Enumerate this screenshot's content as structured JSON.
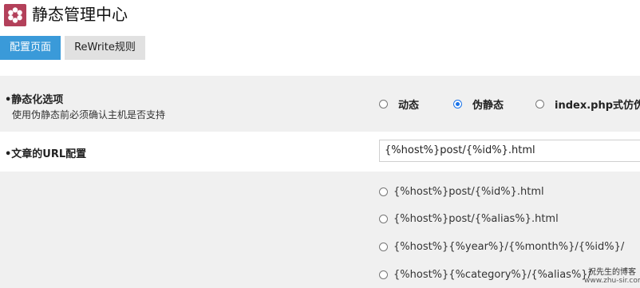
{
  "header": {
    "logo_icon": "flower-logo-icon",
    "logo_color": "#b3405a",
    "title": "静态管理中心"
  },
  "tabs": [
    {
      "label": "配置页面",
      "active": true
    },
    {
      "label": "ReWrite规则",
      "active": false
    }
  ],
  "static_mode": {
    "label": "•静态化选项",
    "sublabel": "使用伪静态前必须确认主机是否支持",
    "options": [
      {
        "label": "动态",
        "checked": false
      },
      {
        "label": "伪静态",
        "checked": true
      },
      {
        "label": "index.php式仿伪",
        "checked": false
      }
    ]
  },
  "article_url": {
    "label": "•文章的URL配置",
    "value": "{%host%}post/{%id%}.html",
    "templates": [
      {
        "label": "{%host%}post/{%id%}.html",
        "checked": false
      },
      {
        "label": "{%host%}post/{%alias%}.html",
        "checked": false
      },
      {
        "label": "{%host%}{%year%}/{%month%}/{%id%}/",
        "checked": false
      },
      {
        "label": "{%host%}{%category%}/{%alias%}/",
        "checked": false
      }
    ]
  },
  "watermark": {
    "line1": "祝先生的博客",
    "line2": "www.zhu-sir.com"
  },
  "colors": {
    "accent": "#3a9ad9",
    "radio_checked": "#1a73e8"
  }
}
